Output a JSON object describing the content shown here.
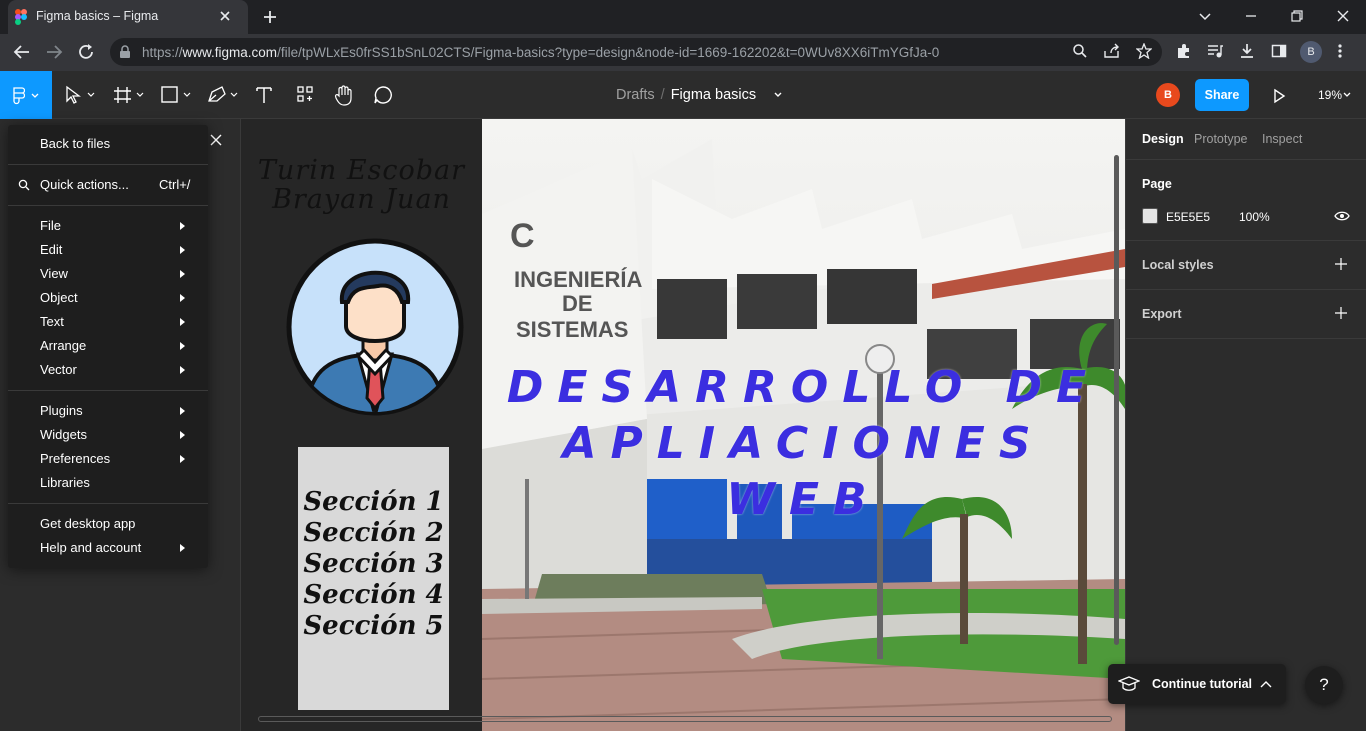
{
  "browser": {
    "tab_title": "Figma basics – Figma",
    "url_prefix": "https://",
    "url_domain": "www.figma.com",
    "url_path": "/file/tpWLxEs0frSS1bSnL02CTS/Figma-basics?type=design&node-id=1669-162202&t=0WUv8XX6iTmYGfJa-0",
    "profile_initial": "B"
  },
  "figma_toolbar": {
    "breadcrumb_drafts": "Drafts",
    "breadcrumb_sep": "/",
    "file_name": "Figma basics",
    "user_initial": "B",
    "share_label": "Share",
    "zoom": "19%"
  },
  "main_menu": {
    "back": "Back to files",
    "quick_actions": "Quick actions...",
    "quick_actions_shortcut": "Ctrl+/",
    "items": [
      "File",
      "Edit",
      "View",
      "Object",
      "Text",
      "Arrange",
      "Vector"
    ],
    "items2": [
      "Plugins",
      "Widgets",
      "Preferences",
      "Libraries"
    ],
    "items3": [
      "Get desktop app",
      "Help and account"
    ]
  },
  "canvas": {
    "name_line1": "Turin Escobar",
    "name_line2": "Brayan Juan",
    "sections": [
      "Sección 1",
      "Sección 2",
      "Sección 3",
      "Sección 4",
      "Sección 5"
    ],
    "hero_line1": "DESARROLLO DE",
    "hero_line2": "APLIACIONES",
    "hero_line3": "WEB",
    "building_sign_letter": "C",
    "building_sign_1": "INGENIERÍA",
    "building_sign_2": "DE",
    "building_sign_3": "SISTEMAS"
  },
  "right_panel": {
    "tabs": [
      "Design",
      "Prototype",
      "Inspect"
    ],
    "page_label": "Page",
    "page_color_hex": "E5E5E5",
    "page_opacity": "100%",
    "local_styles": "Local styles",
    "export": "Export"
  },
  "tutorial": {
    "label": "Continue tutorial",
    "help": "?"
  },
  "colors": {
    "figma_blue": "#0d99ff",
    "hero_text": "#3b2ee0",
    "avatar_red": "#e8491d"
  }
}
